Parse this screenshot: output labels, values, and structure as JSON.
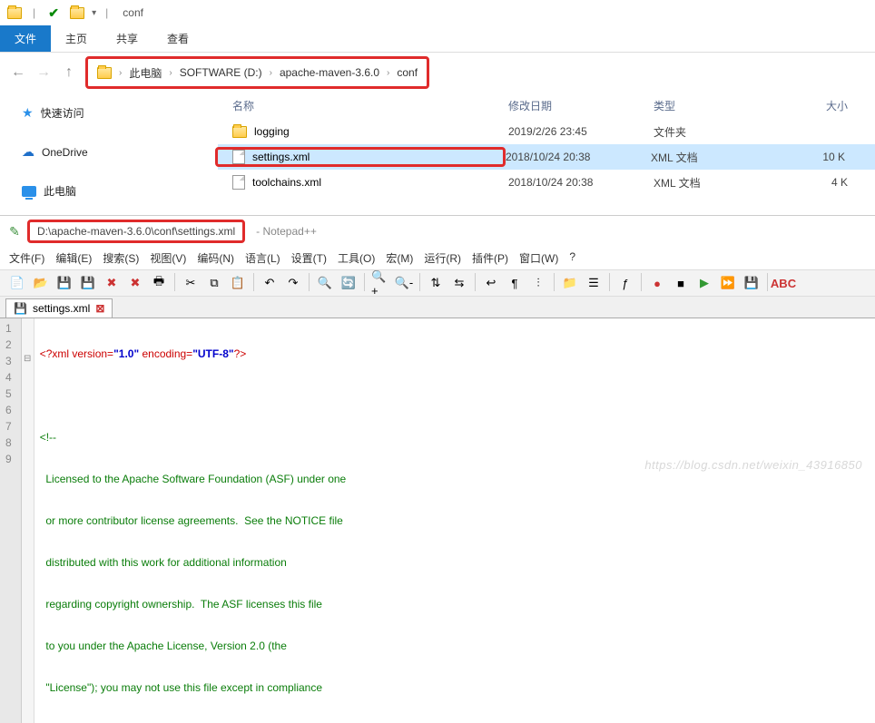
{
  "explorer": {
    "title_pipe": "|",
    "title_folder": "conf",
    "ribbon": {
      "file": "文件",
      "home": "主页",
      "share": "共享",
      "view": "查看"
    },
    "breadcrumb": [
      "此电脑",
      "SOFTWARE (D:)",
      "apache-maven-3.6.0",
      "conf"
    ],
    "sidebar": {
      "quick": "快速访问",
      "onedrive": "OneDrive",
      "pc": "此电脑"
    },
    "columns": {
      "name": "名称",
      "date": "修改日期",
      "type": "类型",
      "size": "大小"
    },
    "rows": [
      {
        "name": "logging",
        "date": "2019/2/26 23:45",
        "type": "文件夹",
        "size": "",
        "icon": "folder",
        "selected": false
      },
      {
        "name": "settings.xml",
        "date": "2018/10/24 20:38",
        "type": "XML 文档",
        "size": "10 K",
        "icon": "file",
        "selected": true
      },
      {
        "name": "toolchains.xml",
        "date": "2018/10/24 20:38",
        "type": "XML 文档",
        "size": "4 K",
        "icon": "file",
        "selected": false
      }
    ]
  },
  "npp": {
    "path": "D:\\apache-maven-3.6.0\\conf\\settings.xml",
    "app": "Notepad++",
    "menu": [
      "文件(F)",
      "编辑(E)",
      "搜索(S)",
      "视图(V)",
      "编码(N)",
      "语言(L)",
      "设置(T)",
      "工具(O)",
      "宏(M)",
      "运行(R)",
      "插件(P)",
      "窗口(W)",
      "?"
    ],
    "tab": "settings.xml",
    "code": {
      "l1_a": "<?xml ",
      "l1_b": "version=",
      "l1_c": "\"1.0\"",
      "l1_d": " encoding=",
      "l1_e": "\"UTF-8\"",
      "l1_f": "?>",
      "l2": "",
      "l3": "<!--",
      "l4": "  Licensed to the Apache Software Foundation (ASF) under one",
      "l5": "  or more contributor license agreements.  See the NOTICE file",
      "l6": "  distributed with this work for additional information",
      "l7": "  regarding copyright ownership.  The ASF licenses this file",
      "l8": "  to you under the Apache License, Version 2.0 (the",
      "l9": "  \"License\"); you may not use this file except in compliance"
    }
  },
  "watermark": "https://blog.csdn.net/weixin_43916850"
}
